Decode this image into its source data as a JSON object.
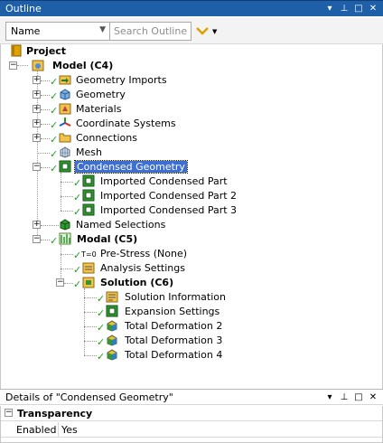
{
  "outline": {
    "title": "Outline",
    "controls": [
      "▾",
      "⊥",
      "□",
      "✕"
    ],
    "filter": {
      "selected": "Name",
      "search_placeholder": "Search Outline"
    }
  },
  "tree": {
    "project": "Project",
    "model": "Model (C4)",
    "model_children": [
      "Geometry Imports",
      "Geometry",
      "Materials",
      "Coordinate Systems",
      "Connections",
      "Mesh"
    ],
    "condensed_geometry": "Condensed Geometry",
    "condensed_parts": [
      "Imported Condensed Part",
      "Imported Condensed Part 2",
      "Imported Condensed Part 3"
    ],
    "named_selections": "Named Selections",
    "modal": "Modal (C5)",
    "modal_children": [
      "Pre-Stress (None)",
      "Analysis Settings"
    ],
    "solution": "Solution (C6)",
    "solution_children": [
      "Solution Information",
      "Expansion Settings",
      "Total Deformation 2",
      "Total Deformation 3",
      "Total Deformation 4"
    ],
    "pre_stress_badge": "T=0"
  },
  "details": {
    "title": "Details of \"Condensed Geometry\"",
    "controls": [
      "▾",
      "⊥",
      "□",
      "✕"
    ],
    "section": "Transparency",
    "property": {
      "label": "Enabled",
      "value": "Yes"
    }
  },
  "colors": {
    "titlebar": "#1f5fa8",
    "selection": "#3c6fd1",
    "check": "#1e9e1e"
  }
}
